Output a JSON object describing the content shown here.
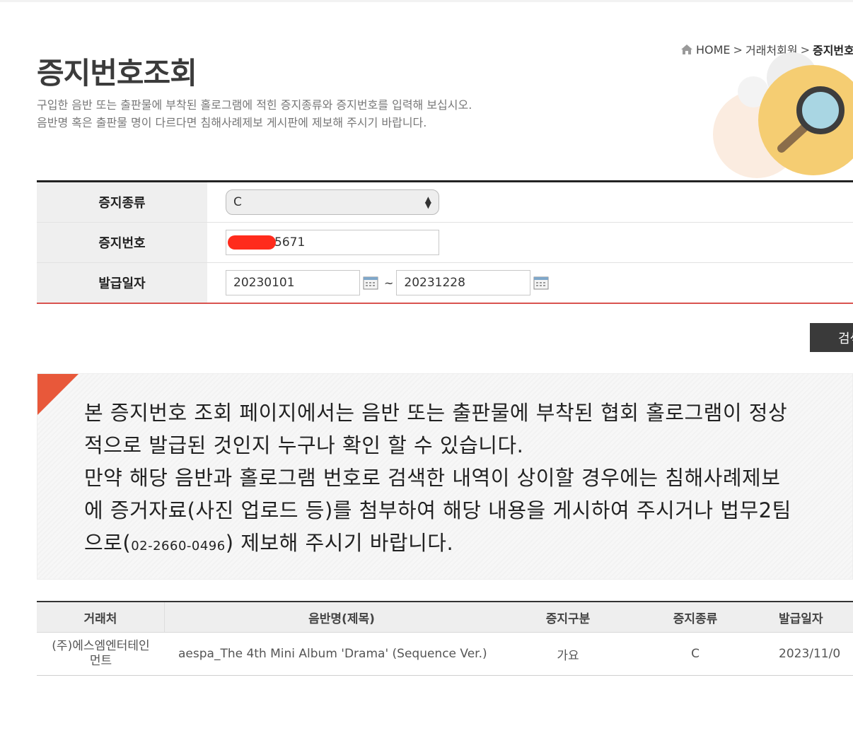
{
  "breadcrumb": {
    "home": "HOME",
    "level1": "거래처회원",
    "current": "증지번호"
  },
  "title": "증지번호조회",
  "description": {
    "line1": "구입한 음반 또는 출판물에 부착된 홀로그램에 적힌 증지종류와 증지번호를 입력해 보십시오.",
    "line2": "음반명 혹은 출판물 명이 다르다면 침해사례제보 게시판에 제보해 주시기 바랍니다."
  },
  "form": {
    "type_label": "증지종류",
    "type_value": "C",
    "number_label": "증지번호",
    "number_value": "5671",
    "date_label": "발급일자",
    "date_from": "20230101",
    "date_sep": "~",
    "date_to": "20231228"
  },
  "search_button": "검색",
  "notice": {
    "line1": "본 증지번호 조회 페이지에서는 음반 또는 출판물에 부착된 협회 홀로그램이 정상",
    "line2": "적으로 발급된 것인지 누구나 확인 할 수 있습니다.",
    "line3": "만약 해당 음반과 홀로그램 번호로 검색한 내역이 상이할 경우에는 침해사례제보",
    "line4": "에 증거자료(사진 업로드 등)를 첨부하여 해당 내용을 게시하여 주시거나 법무2팀",
    "line5_a": "으로(",
    "line5_phone": "02-2660-0496",
    "line5_b": ") 제보해 주시기 바랍니다."
  },
  "results": {
    "headers": [
      "거래처",
      "음반명(제목)",
      "증지구분",
      "증지종류",
      "발급일자"
    ],
    "rows": [
      {
        "company_l1": "(주)에스엠엔터테인",
        "company_l2": "먼트",
        "album": "aespa_The 4th Mini Album 'Drama' (Sequence Ver.)",
        "category": "가요",
        "type": "C",
        "date": "2023/11/0"
      }
    ]
  },
  "colors": {
    "accent_red": "#e8583a",
    "header_border": "#222222",
    "button_bg": "#3a3a3a"
  },
  "icons": [
    "home-icon",
    "magnifier-icon",
    "calendar-icon"
  ]
}
